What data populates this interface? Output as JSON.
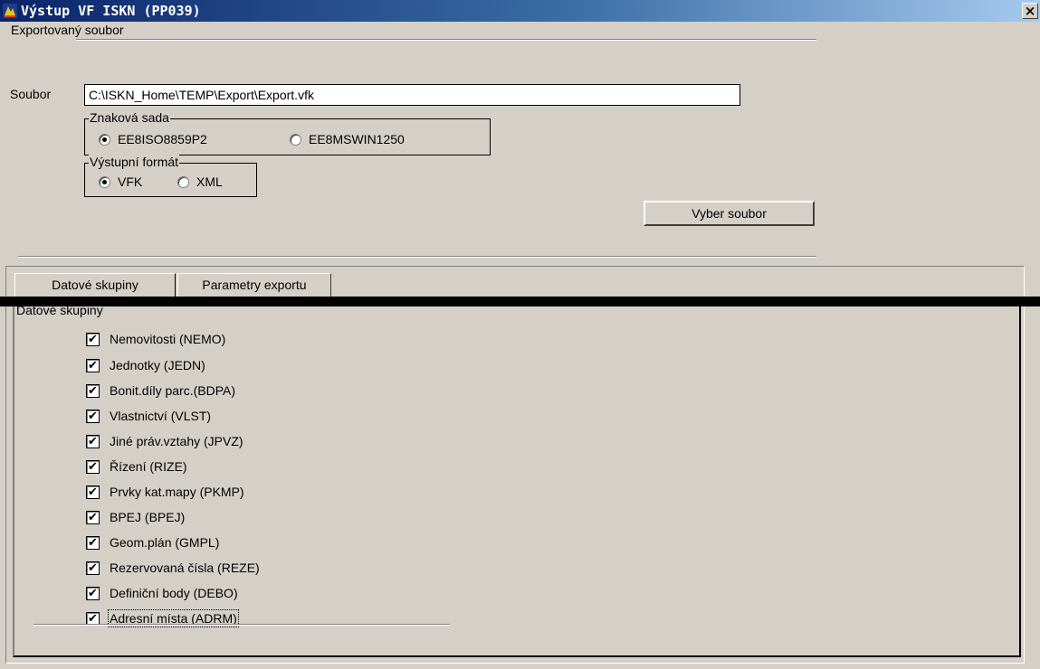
{
  "window": {
    "title": "Výstup VF ISKN (PP039)",
    "close_label": "×"
  },
  "section_label": "Exportovaný soubor",
  "file": {
    "label": "Soubor",
    "value": "C:\\ISKN_Home\\TEMP\\Export\\Export.vfk"
  },
  "charset_group": {
    "legend": "Znaková sada",
    "options": [
      {
        "label": "EE8ISO8859P2",
        "checked": true
      },
      {
        "label": "EE8MSWIN1250",
        "checked": false
      }
    ]
  },
  "format_group": {
    "legend": "Výstupní formát",
    "options": [
      {
        "label": "VFK",
        "checked": true
      },
      {
        "label": "XML",
        "checked": false
      }
    ]
  },
  "select_button": {
    "label": "Vyber soubor"
  },
  "tabs": [
    {
      "label": "Datové skupiny",
      "active": true
    },
    {
      "label": "Parametry exportu",
      "active": false
    }
  ],
  "groups_panel": {
    "heading": "Datové skupiny",
    "items": [
      {
        "label": "Nemovitosti (NEMO)",
        "checked": true
      },
      {
        "label": "Jednotky (JEDN)",
        "checked": true
      },
      {
        "label": "Bonit.díly parc.(BDPA)",
        "checked": true
      },
      {
        "label": "Vlastnictví (VLST)",
        "checked": true
      },
      {
        "label": "Jiné práv.vztahy (JPVZ)",
        "checked": true
      },
      {
        "label": "Řízení (RIZE)",
        "checked": true
      },
      {
        "label": "Prvky kat.mapy (PKMP)",
        "checked": true
      },
      {
        "label": "BPEJ (BPEJ)",
        "checked": true
      },
      {
        "label": "Geom.plán (GMPL)",
        "checked": true
      },
      {
        "label": "Rezervovaná čísla (REZE)",
        "checked": true
      },
      {
        "label": "Definiční body (DEBO)",
        "checked": true
      },
      {
        "label": "Adresní místa (ADRM)",
        "checked": true
      }
    ]
  },
  "check_mark": "✔"
}
